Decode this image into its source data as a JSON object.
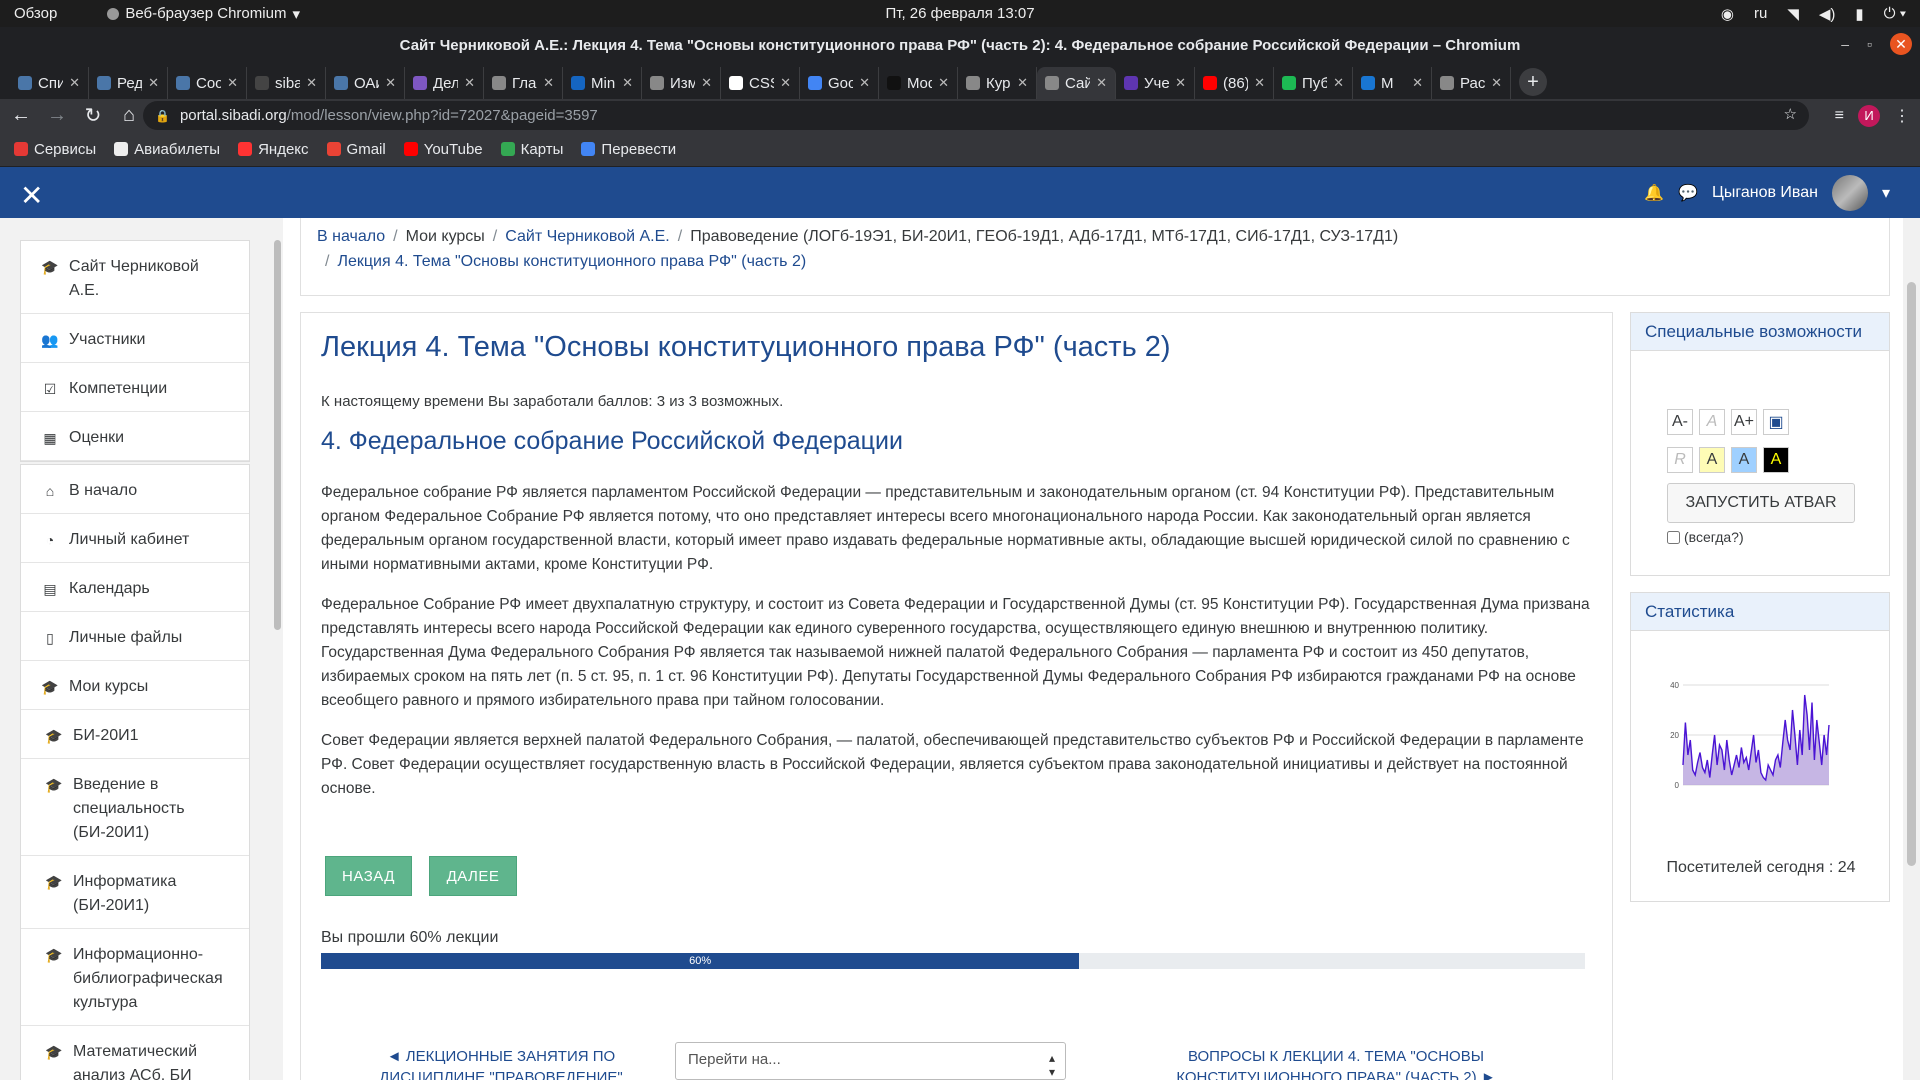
{
  "system": {
    "overview": "Обзор",
    "app_name": "Веб-браузер Chromium",
    "clock": "Пт, 26 февраля  13:07",
    "lang": "ru"
  },
  "window_title": "Сайт Черниковой А.Е.: Лекция 4. Тема \"Основы конституционного права РФ\" (часть 2): 4. Федеральное собрание Российской Федерации – Chromium",
  "tabs": [
    {
      "label": "Спис",
      "color": "#4a76a8"
    },
    {
      "label": "Реда",
      "color": "#4a76a8"
    },
    {
      "label": "Сооб",
      "color": "#4a76a8"
    },
    {
      "label": "sibad",
      "color": "#444"
    },
    {
      "label": "ОАи",
      "color": "#4a76a8"
    },
    {
      "label": "Дела",
      "color": "#7e57c2"
    },
    {
      "label": "Глав",
      "color": "#888"
    },
    {
      "label": "Minu",
      "color": "#1565c0"
    },
    {
      "label": "Изме",
      "color": "#888"
    },
    {
      "label": "CSS:",
      "color": "#fff"
    },
    {
      "label": "Goog",
      "color": "#4285f4"
    },
    {
      "label": "Mod",
      "color": "#111"
    },
    {
      "label": "Курс",
      "color": "#888"
    },
    {
      "label": "Сайт",
      "color": "#888"
    },
    {
      "label": "Учеб",
      "color": "#5e35b1"
    },
    {
      "label": "(86)",
      "color": "#ff0000"
    },
    {
      "label": "Публ",
      "color": "#1db954"
    },
    {
      "label": "М",
      "color": "#1976d2"
    },
    {
      "label": "Расп",
      "color": "#888"
    }
  ],
  "active_tab_index": 13,
  "url": {
    "host": "portal.sibadi.org",
    "path": "/mod/lesson/view.php?id=72027&pageid=3597"
  },
  "profile_initial": "И",
  "bookmarks": [
    {
      "label": "Сервисы",
      "color": "#e53935"
    },
    {
      "label": "Авиабилеты",
      "color": "#eeeeee"
    },
    {
      "label": "Яндекс",
      "color": "#ff3333"
    },
    {
      "label": "Gmail",
      "color": "#ea4335"
    },
    {
      "label": "YouTube",
      "color": "#ff0000"
    },
    {
      "label": "Карты",
      "color": "#34a853"
    },
    {
      "label": "Перевести",
      "color": "#4285f4"
    }
  ],
  "user": {
    "name": "Цыганов Иван"
  },
  "sidebar": [
    [
      {
        "label": "Сайт Черниковой А.Е.",
        "icon": "graduation-cap-icon"
      },
      {
        "label": "Участники",
        "icon": "users-icon"
      },
      {
        "label": "Компетенции",
        "icon": "check-square-icon"
      },
      {
        "label": "Оценки",
        "icon": "table-icon"
      }
    ],
    [
      {
        "label": "В начало",
        "icon": "home-icon"
      },
      {
        "label": "Личный кабинет",
        "icon": "dashboard-icon"
      },
      {
        "label": "Календарь",
        "icon": "calendar-icon"
      },
      {
        "label": "Личные файлы",
        "icon": "file-icon"
      },
      {
        "label": "Мои курсы",
        "icon": "graduation-cap-icon"
      },
      {
        "label": "БИ-20И1",
        "icon": "graduation-cap-icon"
      },
      {
        "label": "Введение в специальность (БИ-20И1)",
        "icon": "graduation-cap-icon"
      },
      {
        "label": "Информатика (БИ-20И1)",
        "icon": "graduation-cap-icon"
      },
      {
        "label": "Информационно-библиографическая культура",
        "icon": "graduation-cap-icon"
      },
      {
        "label": "Математический анализ АСб, БИ",
        "icon": "graduation-cap-icon"
      }
    ]
  ],
  "breadcrumb": {
    "home": "В начало",
    "my_courses": "Мои курсы",
    "site": "Сайт Черниковой А.Е.",
    "course": "Правоведение (ЛОГб-19Э1, БИ-20И1, ГЕОб-19Д1, АДб-17Д1, МТб-17Д1, СИб-17Д1, СУЗ-17Д1)",
    "lesson": "Лекция 4. Тема \"Основы конституционного права РФ\" (часть 2)"
  },
  "lesson": {
    "title": "Лекция 4. Тема \"Основы конституционного права РФ\" (часть 2)",
    "score": "К настоящему времени Вы заработали баллов: 3 из 3 возможных.",
    "page_title": "4. Федеральное собрание Российской Федерации",
    "p1": "Федеральное собрание РФ является парламентом Российской Федерации — представительным и законодательным органом (ст. 94 Конституции РФ). Представительным органом Федеральное Собрание РФ является потому, что оно представляет интересы всего многонационального народа России. Как законодательный орган является федеральным органом государственной власти, который имеет право издавать федеральные нормативные акты, обладающие высшей юридической силой по сравнению с иными нормативными актами, кроме Конституции РФ.",
    "p2": "Федеральное Собрание РФ имеет двухпалатную структуру, и состоит из Совета Федерации и Государственной Думы (ст. 95 Конституции РФ). Государственная Дума призвана представлять интересы всего народа Российской Федерации как единого суверенного государства, осуществляющего единую внешнюю и внутреннюю политику. Государственная Дума Федерального Собрания РФ является так называемой нижней палатой Федерального Собрания — парламента РФ и состоит из 450 депутатов, избираемых сроком на пять лет (п. 5 ст. 95, п. 1 ст. 96 Конституции РФ). Депутаты Государственной Думы Федерального Собрания РФ избираются гражданами РФ на основе всеобщего равного и прямого избирательного права при тайном голосовании.",
    "p3": "Совет Федерации является верхней палатой Федерального Собрания, — палатой, обеспечивающей представительство субъектов РФ и Российской Федерации в парламенте РФ. Совет Федерации осуществляет государственную власть в Российской Федерации, является субъектом права законодательной инициативы и действует на постоянной основе.",
    "back_label": "НАЗАД",
    "next_label": "ДАЛЕЕ",
    "progress_text": "Вы прошли 60% лекции",
    "progress_value": 60,
    "progress_label": "60%",
    "prev_activity": "◄ ЛЕКЦИОННЫЕ ЗАНЯТИЯ ПО ДИСЦИПЛИНЕ \"ПРАВОВЕДЕНИЕ\"",
    "jump_placeholder": "Перейти на...",
    "next_activity": "ВОПРОСЫ К ЛЕКЦИИ 4. ТЕМА  \"ОСНОВЫ КОНСТИТУЦИОННОГО ПРАВА\" (ЧАСТЬ 2) ►"
  },
  "accessibility": {
    "title": "Специальные возможности",
    "font_buttons": [
      "A-",
      "A",
      "A+"
    ],
    "color_buttons": [
      "R",
      "A",
      "A",
      "A"
    ],
    "atbar_button": "ЗАПУСТИТЬ ATBAR",
    "always_label": "(всегда?)"
  },
  "stats": {
    "title": "Статистика",
    "visitors_text": "Посетителей сегодня : 24"
  },
  "chart_data": {
    "type": "area",
    "ylim": [
      0,
      40
    ],
    "yticks": [
      "0",
      "20",
      "40"
    ],
    "values": [
      8,
      25,
      12,
      18,
      6,
      4,
      9,
      13,
      7,
      5,
      10,
      3,
      12,
      20,
      8,
      16,
      14,
      6,
      18,
      10,
      4,
      8,
      12,
      7,
      15,
      9,
      11,
      6,
      13,
      20,
      9,
      14,
      5,
      3,
      2,
      8,
      6,
      4,
      10,
      12,
      7,
      17,
      26,
      18,
      14,
      30,
      20,
      8,
      22,
      12,
      36,
      28,
      14,
      33,
      10,
      26,
      17,
      8,
      20,
      12,
      24
    ]
  }
}
